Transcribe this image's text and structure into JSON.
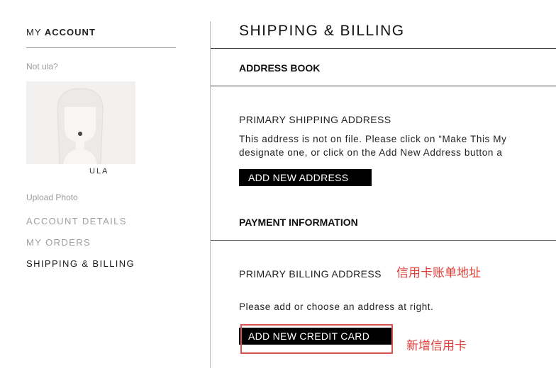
{
  "sidebar": {
    "title_prefix": "MY",
    "title_bold": "ACCOUNT",
    "not_user": "Not ula?",
    "avatar_name": "ULA",
    "upload_photo": "Upload Photo",
    "nav": [
      {
        "label": "ACCOUNT DETAILS",
        "active": false
      },
      {
        "label": "MY ORDERS",
        "active": false
      },
      {
        "label": "SHIPPING & BILLING",
        "active": true
      }
    ]
  },
  "main": {
    "title": "SHIPPING & BILLING",
    "address_book": {
      "heading": "ADDRESS BOOK",
      "primary_shipping_label": "PRIMARY SHIPPING ADDRESS",
      "info_line1": "This address is not on file. Please click on “Make This My",
      "info_line2": "designate one, or click on the Add New Address button a",
      "add_address_button": "ADD NEW ADDRESS"
    },
    "payment": {
      "heading": "PAYMENT INFORMATION",
      "primary_billing_label": "PRIMARY BILLING ADDRESS",
      "billing_note": "Please add or choose an address at right.",
      "add_card_button": "ADD NEW CREDIT CARD"
    }
  },
  "annotations": {
    "billing_address_note": "信用卡账单地址",
    "add_card_note": "新增信用卡",
    "color": "#e0403a"
  }
}
